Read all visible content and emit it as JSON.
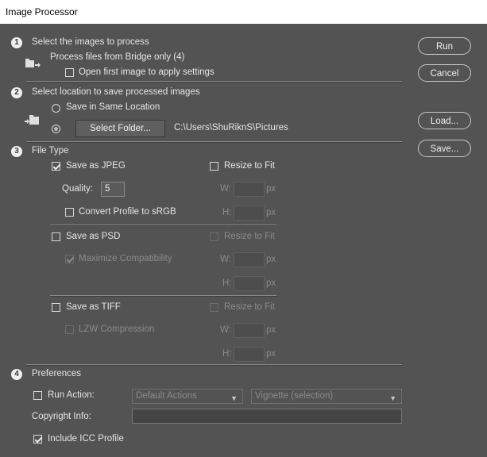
{
  "window": {
    "title": "Image Processor"
  },
  "section1": {
    "number": "1",
    "heading": "Select the images to process",
    "source_text": "Process files from Bridge only (4)",
    "open_first_label": "Open first image to apply settings",
    "open_first_checked": false
  },
  "section2": {
    "number": "2",
    "heading": "Select location to save processed images",
    "same_location_label": "Save in Same Location",
    "select_folder_label": "Select Folder...",
    "folder_path": "C:\\Users\\ShuRiknS\\Pictures",
    "selected_option": "select_folder"
  },
  "section3": {
    "number": "3",
    "heading": "File Type",
    "jpeg": {
      "label": "Save as JPEG",
      "checked": true,
      "quality_label": "Quality:",
      "quality_value": "5",
      "convert_label": "Convert Profile to sRGB",
      "convert_checked": false,
      "resize_label": "Resize to Fit",
      "resize_checked": false,
      "w_label": "W:",
      "h_label": "H:",
      "unit": "px"
    },
    "psd": {
      "label": "Save as PSD",
      "checked": false,
      "maximize_label": "Maximize Compatibility",
      "maximize_checked": true,
      "resize_label": "Resize to Fit",
      "w_label": "W:",
      "h_label": "H:",
      "unit": "px"
    },
    "tiff": {
      "label": "Save as TIFF",
      "checked": false,
      "lzw_label": "LZW Compression",
      "lzw_checked": false,
      "resize_label": "Resize to Fit",
      "w_label": "W:",
      "h_label": "H:",
      "unit": "px"
    }
  },
  "section4": {
    "number": "4",
    "heading": "Preferences",
    "run_action_label": "Run Action:",
    "run_action_checked": false,
    "action_set": "Default Actions",
    "action_name": "Vignette (selection)",
    "copyright_label": "Copyright Info:",
    "copyright_value": "",
    "icc_label": "Include ICC Profile",
    "icc_checked": true
  },
  "buttons": {
    "run": "Run",
    "cancel": "Cancel",
    "load": "Load...",
    "save": "Save..."
  },
  "icons": {
    "bridge": "bridge-files-icon",
    "folder": "folder-arrow-icon",
    "chevron": "chevron-down-icon"
  },
  "colors": {
    "panel": "#535353",
    "titlebar": "#ffffff",
    "text": "#e6e6e6",
    "disabled_text": "#8b8b8b"
  }
}
